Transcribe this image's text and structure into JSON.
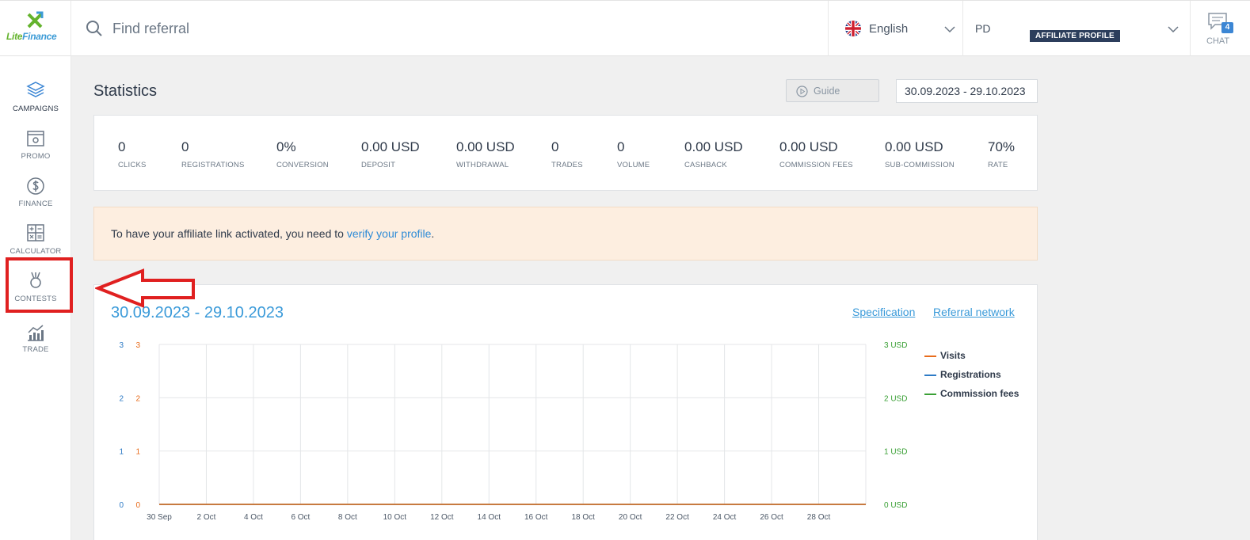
{
  "brand": {
    "logo_lite": "Lite",
    "logo_finance": "Finance",
    "logo_colors": {
      "green": "#64b32d",
      "blue": "#3c9bd6"
    }
  },
  "header": {
    "search_placeholder": "Find referral",
    "language": "English",
    "profile_initials": "PD",
    "profile_badge": "AFFILIATE PROFILE",
    "chat_label": "CHAT",
    "chat_count": "4"
  },
  "sidebar": {
    "items": [
      {
        "label": "CAMPAIGNS",
        "icon": "layers-icon",
        "active": true
      },
      {
        "label": "PROMO",
        "icon": "promo-icon",
        "active": false
      },
      {
        "label": "FINANCE",
        "icon": "dollar-icon",
        "active": false
      },
      {
        "label": "CALCULATOR",
        "icon": "calculator-icon",
        "active": false
      },
      {
        "label": "CONTESTS",
        "icon": "medal-icon",
        "active": false
      },
      {
        "label": "TRADE",
        "icon": "trade-chart-icon",
        "active": false
      }
    ]
  },
  "main": {
    "title": "Statistics",
    "guide_label": "Guide",
    "date_range": "30.09.2023 - 29.10.2023",
    "stats": [
      {
        "value": "0",
        "label": "CLICKS"
      },
      {
        "value": "0",
        "label": "REGISTRATIONS"
      },
      {
        "value": "0%",
        "label": "CONVERSION"
      },
      {
        "value": "0.00 USD",
        "label": "DEPOSIT"
      },
      {
        "value": "0.00 USD",
        "label": "WITHDRAWAL"
      },
      {
        "value": "0",
        "label": "TRADES"
      },
      {
        "value": "0",
        "label": "VOLUME"
      },
      {
        "value": "0.00 USD",
        "label": "CASHBACK"
      },
      {
        "value": "0.00 USD",
        "label": "COMMISSION FEES"
      },
      {
        "value": "0.00 USD",
        "label": "SUB-COMMISSION"
      },
      {
        "value": "70%",
        "label": "RATE"
      }
    ],
    "notice": {
      "text_before": "To have your affiliate link activated, you need to ",
      "link_text": "verify your profile",
      "text_after": "."
    },
    "chart_header": {
      "date": "30.09.2023 - 29.10.2023",
      "specification_link": "Specification",
      "referral_network_link": "Referral network"
    }
  },
  "colors": {
    "accent_blue": "#3a9ad9",
    "visits": "#e86c1c",
    "registrations": "#2e7bc6",
    "commission": "#3aa035",
    "highlight_red": "#e02020"
  },
  "chart_data": {
    "type": "line",
    "x": [
      "30 Sep",
      "2 Oct",
      "4 Oct",
      "6 Oct",
      "8 Oct",
      "10 Oct",
      "12 Oct",
      "14 Oct",
      "16 Oct",
      "18 Oct",
      "20 Oct",
      "22 Oct",
      "24 Oct",
      "26 Oct",
      "28 Oct"
    ],
    "y_left_registrations_ticks": [
      "0",
      "1",
      "2",
      "3"
    ],
    "y_left_visits_ticks": [
      "0",
      "1",
      "2",
      "3"
    ],
    "y_right_ticks": [
      "0 USD",
      "1 USD",
      "2 USD",
      "3 USD"
    ],
    "ylim": [
      0,
      3
    ],
    "grid": true,
    "legend_placement": "right",
    "series": [
      {
        "name": "Visits",
        "color": "#e86c1c",
        "values": [
          0,
          0,
          0,
          0,
          0,
          0,
          0,
          0,
          0,
          0,
          0,
          0,
          0,
          0,
          0
        ]
      },
      {
        "name": "Registrations",
        "color": "#2e7bc6",
        "values": [
          0,
          0,
          0,
          0,
          0,
          0,
          0,
          0,
          0,
          0,
          0,
          0,
          0,
          0,
          0
        ]
      },
      {
        "name": "Commission fees",
        "color": "#3aa035",
        "values": [
          0,
          0,
          0,
          0,
          0,
          0,
          0,
          0,
          0,
          0,
          0,
          0,
          0,
          0,
          0
        ]
      }
    ]
  }
}
